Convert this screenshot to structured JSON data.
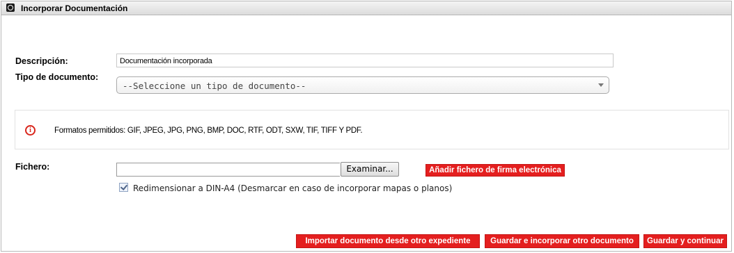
{
  "window": {
    "title": "Incorporar Documentación",
    "title_icon": "fingerprint-icon"
  },
  "form": {
    "description_label": "Descripción:",
    "description_value": "Documentación incorporada",
    "doc_type_label": "Tipo de documento:",
    "doc_type_selected": "--Seleccione un tipo de documento--",
    "file_label": "Fichero:",
    "file_value": "",
    "browse_label": "Examinar...",
    "add_signature_label": "Añadir fichero de firma electrónica",
    "resize_checked": true,
    "resize_label": "Redimensionar a DIN-A4 (Desmarcar en caso de incorporar mapas o planos)"
  },
  "info": {
    "icon": "info-icon",
    "text": "Formatos permitidos: GIF, JPEG, JPG, PNG, BMP, DOC, RTF, ODT, SXW, TIF, TIFF Y PDF."
  },
  "actions": {
    "import_label": "Importar documento desde otro expediente",
    "save_add_label": "Guardar e incorporar otro documento",
    "save_continue_label": "Guardar y continuar"
  },
  "colors": {
    "accent_red": "#e41f1f",
    "info_icon": "#d9261c"
  }
}
